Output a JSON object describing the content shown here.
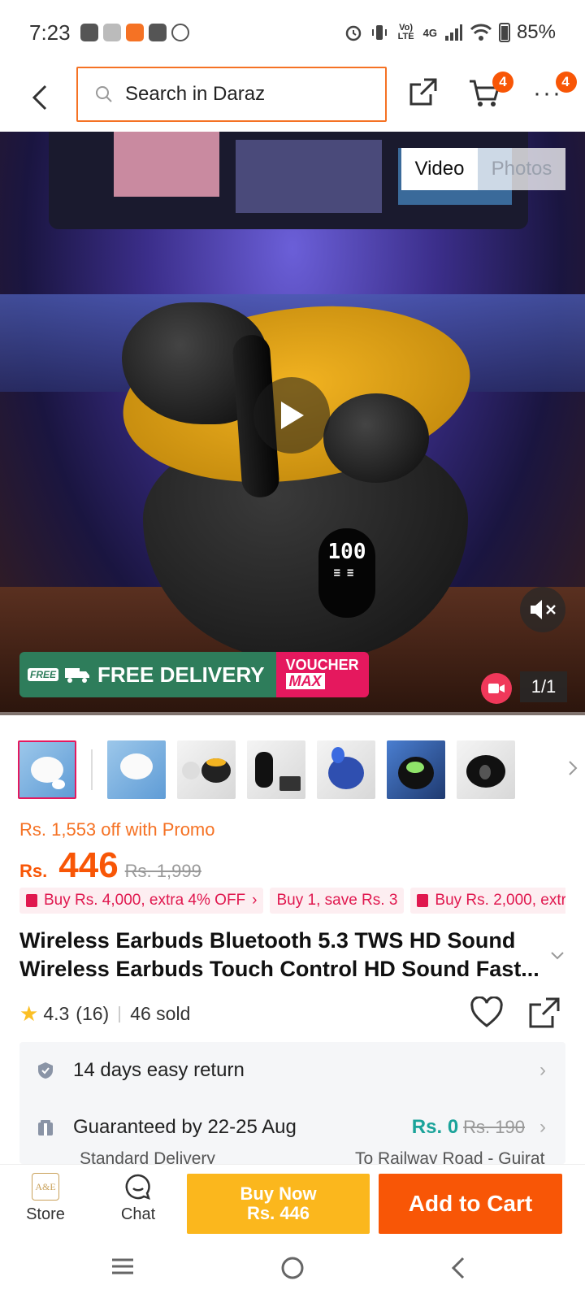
{
  "status": {
    "time": "7:23",
    "battery": "85%",
    "network": "4G",
    "volte": "Vo) LTE"
  },
  "nav": {
    "search_placeholder": "Search in Daraz",
    "cart_badge": "4",
    "more_badge": "4"
  },
  "media": {
    "tab_video": "Video",
    "tab_photos": "Photos",
    "counter": "1/1",
    "display_value": "100",
    "free_tag": "FREE",
    "free_delivery": "FREE DELIVERY",
    "voucher": "VOUCHER",
    "voucher_max": "MAX"
  },
  "pricing": {
    "promo_text": "Rs. 1,553 off with Promo",
    "currency": "Rs.",
    "price": "446",
    "old_price": "Rs. 1,999",
    "chips": [
      "Buy Rs. 4,000, extra 4% OFF",
      "Buy 1, save Rs. 3",
      "Buy Rs. 2,000, extr"
    ]
  },
  "product": {
    "title": "Wireless Earbuds Bluetooth 5.3 TWS HD Sound Wireless Earbuds Touch Control HD Sound Fast...",
    "rating": "4.3",
    "reviews": "(16)",
    "sold": "46 sold"
  },
  "services": {
    "return": "14 days easy return",
    "guarantee": "Guaranteed by 22-25 Aug",
    "fee_new": "Rs. 0",
    "fee_old": "Rs. 190",
    "delivery_type": "Standard Delivery",
    "delivery_to": "To Railway Road - Gujrat"
  },
  "bottom": {
    "store": "Store",
    "chat": "Chat",
    "buy_now": "Buy Now",
    "buy_now_price": "Rs. 446",
    "add_to_cart": "Add to Cart",
    "logo_text": "A&E"
  },
  "colors": {
    "accent": "#f85606",
    "buy_now": "#fbb71d",
    "promo_pink": "#e0184f",
    "fee_green": "#1aa39a"
  }
}
